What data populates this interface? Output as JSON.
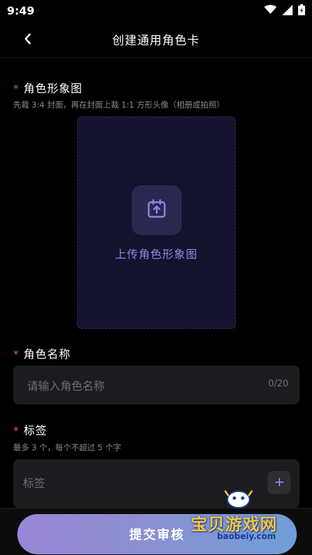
{
  "status_bar": {
    "time": "9:49"
  },
  "nav": {
    "title": "创建通用角色卡"
  },
  "image_section": {
    "required_mark": "*",
    "label": "角色形象图",
    "hint": "先裁 3:4 封面，再在封面上裁 1:1 方形头像（相册或拍照）",
    "upload_label": "上传角色形象图"
  },
  "name_section": {
    "required_mark": "*",
    "label": "角色名称",
    "placeholder": "请输入角色名称",
    "value": "",
    "counter": "0/20"
  },
  "tag_section": {
    "required_mark": "*",
    "label": "标签",
    "hint": "最多 3 个，每个不超过 5 个字",
    "placeholder": "标签",
    "value": ""
  },
  "footer": {
    "submit_label": "提交审核"
  },
  "watermark": {
    "main": "宝贝游戏网",
    "url": "baobeiy.com"
  },
  "colors": {
    "accent": "#8e88e6",
    "required": "#e8543e",
    "background": "#000000",
    "field": "#1c1c1e"
  }
}
